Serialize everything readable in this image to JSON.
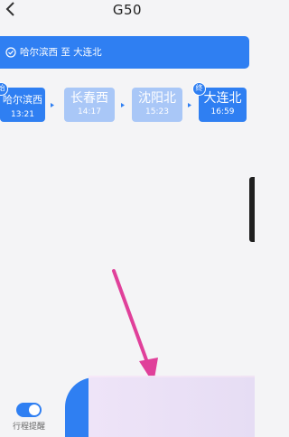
{
  "header": {
    "title": "G50",
    "back_icon": "chevron-left-icon"
  },
  "route": {
    "label": "哈尔滨西 至 大连北",
    "icon": "check-circle-icon"
  },
  "stations": [
    {
      "name": "哈尔滨西",
      "time": "13:21",
      "badge": "始"
    },
    {
      "name": "长春西",
      "time": "14:17",
      "badge": ""
    },
    {
      "name": "沈阳北",
      "time": "15:23",
      "badge": ""
    },
    {
      "name": "大连北",
      "time": "16:59",
      "badge": "终"
    }
  ],
  "footer": {
    "reminder_label": "行程提醒",
    "reminder_on": true
  },
  "colors": {
    "accent": "#2f7ff2",
    "faded_station": "#a9c7f7",
    "annotation_arrow": "#e0409a"
  }
}
